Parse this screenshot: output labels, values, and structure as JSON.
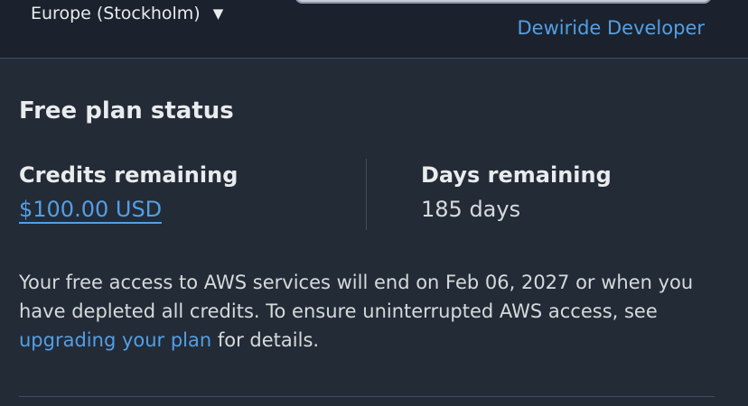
{
  "header": {
    "region": "Europe (Stockholm)",
    "region_caret": "▼",
    "account_name": "Dewiride Developer"
  },
  "free_plan": {
    "title": "Free plan status",
    "credits_label": "Credits remaining",
    "credits_value": "$100.00 USD",
    "days_label": "Days remaining",
    "days_value": "185 days",
    "description_before": "Your free access to AWS services will end on Feb 06, 2027 or when you have depleted all credits. To ensure uninterrupted AWS access, see ",
    "description_link": "upgrading your plan",
    "description_after": " for details."
  },
  "colors": {
    "background": "#232b37",
    "header_background": "#1b222d",
    "link": "#539fe5",
    "divider": "#414d5c",
    "text_primary": "#e9ebed",
    "text_secondary": "#d5dbdb"
  },
  "icons": {
    "region_caret": "caret-down-icon"
  }
}
